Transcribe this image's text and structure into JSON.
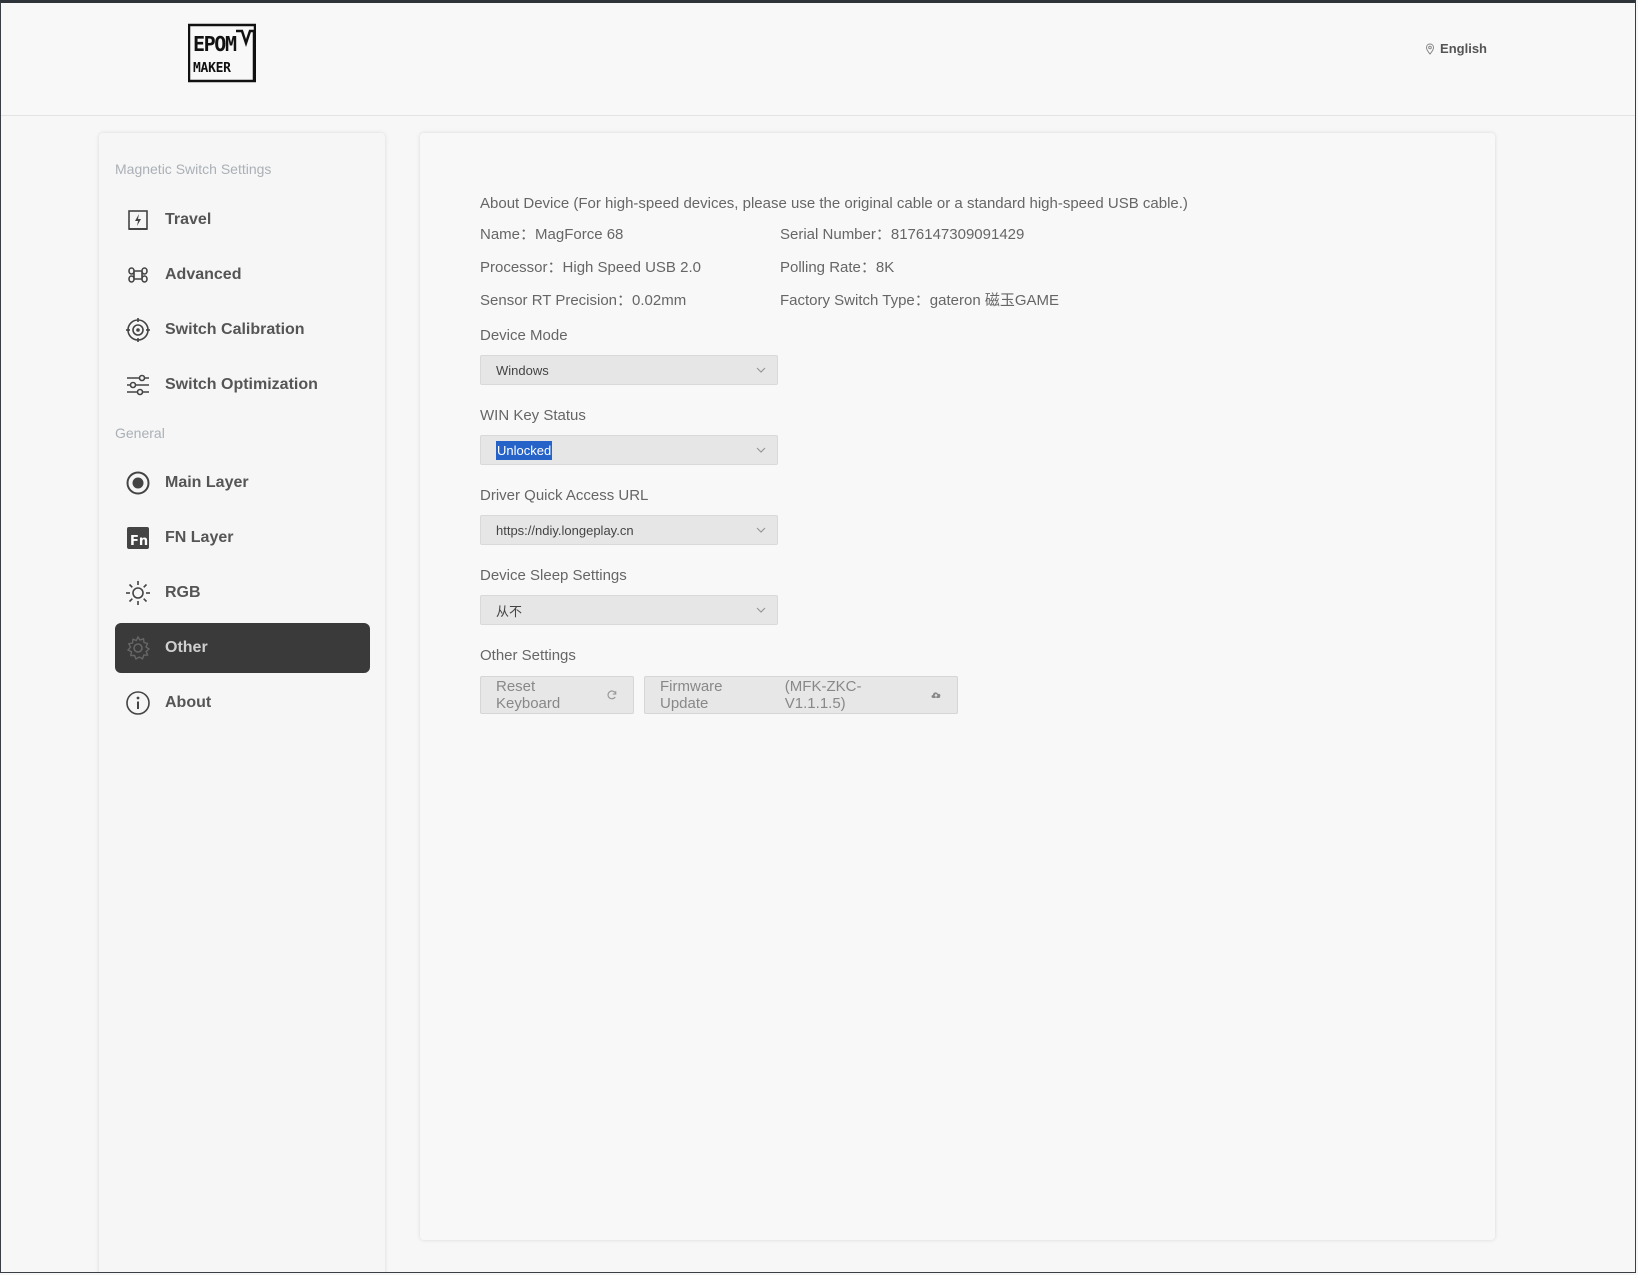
{
  "header": {
    "logo_top": "EPOM",
    "logo_bottom": "MAKER",
    "language": "English"
  },
  "sidebar": {
    "section_magnetic": "Magnetic Switch Settings",
    "section_general": "General",
    "items": [
      {
        "label": "Travel",
        "icon": "travel-icon"
      },
      {
        "label": "Advanced",
        "icon": "command-icon"
      },
      {
        "label": "Switch Calibration",
        "icon": "calibration-icon"
      },
      {
        "label": "Switch Optimization",
        "icon": "sliders-icon"
      },
      {
        "label": "Main Layer",
        "icon": "main-layer-icon"
      },
      {
        "label": "FN Layer",
        "icon": "fn-icon"
      },
      {
        "label": "RGB",
        "icon": "sun-icon"
      },
      {
        "label": "Other",
        "icon": "gear-icon",
        "active": true
      },
      {
        "label": "About",
        "icon": "info-icon"
      }
    ]
  },
  "about": {
    "heading": "About Device (For high-speed devices, please use the original cable or a standard high-speed USB cable.)",
    "name_label": "Name：",
    "name_value": "MagForce 68",
    "serial_label": "Serial Number：",
    "serial_value": "8176147309091429",
    "processor_label": "Processor：",
    "processor_value": "High Speed USB 2.0",
    "polling_label": "Polling Rate：",
    "polling_value": "8K",
    "sensor_label": "Sensor RT Precision：",
    "sensor_value": "0.02mm",
    "switch_type_label": "Factory Switch Type：",
    "switch_type_value": "gateron 磁玉GAME"
  },
  "settings": {
    "device_mode_label": "Device Mode",
    "device_mode_value": "Windows",
    "win_key_label": "WIN Key Status",
    "win_key_value": "Unlocked",
    "driver_url_label": "Driver Quick Access URL",
    "driver_url_value": "https://ndiy.longeplay.cn",
    "sleep_label": "Device Sleep Settings",
    "sleep_value": "从不",
    "other_label": "Other Settings",
    "reset_button": "Reset Keyboard",
    "firmware_button": "Firmware Update",
    "firmware_version": "(MFK-ZKC-V1.1.1.5)"
  }
}
